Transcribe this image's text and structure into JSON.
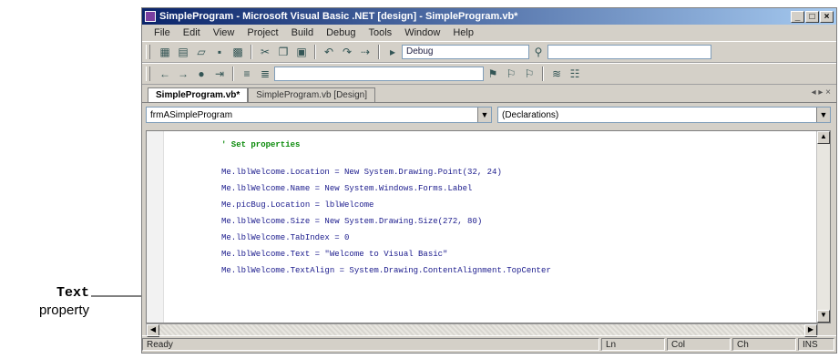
{
  "annotation": {
    "code_label": "Text",
    "plain_label": "property"
  },
  "window": {
    "title": "SimpleProgram - Microsoft Visual Basic .NET [design] - SimpleProgram.vb*",
    "buttons": {
      "minimize": "_",
      "maximize": "□",
      "close": "×"
    }
  },
  "menu": [
    "File",
    "Edit",
    "View",
    "Project",
    "Build",
    "Debug",
    "Tools",
    "Window",
    "Help"
  ],
  "toolbar": {
    "config": "Debug",
    "find": ""
  },
  "tabs": {
    "active": "SimpleProgram.vb*",
    "other": "SimpleProgram.vb [Design]",
    "controls": "◂ ▸ ×"
  },
  "combos": {
    "class": "frmASimpleProgram",
    "method": "(Declarations)"
  },
  "code": {
    "comment": "' Set properties",
    "lines": [
      "Me.lblWelcome.Location = New System.Drawing.Point(32, 24)",
      "Me.lblWelcome.Name = New System.Windows.Forms.Label",
      "Me.picBug.Location = lblWelcome",
      "Me.lblWelcome.Size = New System.Drawing.Size(272, 80)",
      "Me.lblWelcome.TabIndex = 0",
      "Me.lblWelcome.Text = \"Welcome to Visual Basic\"",
      "Me.lblWelcome.TextAlign = System.Drawing.ContentAlignment.TopCenter"
    ]
  },
  "status": {
    "text": "Ready",
    "ln": "Ln",
    "col": "Col",
    "ch": "Ch",
    "ins": "INS"
  }
}
